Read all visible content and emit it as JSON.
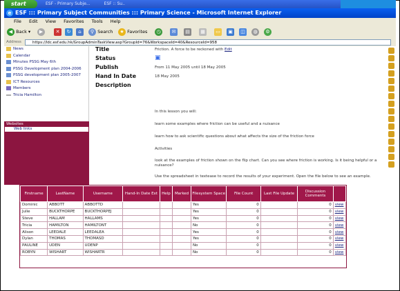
{
  "taskbar": {
    "start_label": "start",
    "items": [
      "",
      "",
      "ESF - Primary Subje...",
      "ESF :: Su.."
    ]
  },
  "window": {
    "title": "ESF ::: Primary Subject Communities ::: Primary Science - Microsoft Internet Explorer"
  },
  "menu": [
    "File",
    "Edit",
    "View",
    "Favorites",
    "Tools",
    "Help"
  ],
  "toolbar": {
    "back": "Back",
    "search": "Search",
    "favorites": "Favorites"
  },
  "address": {
    "label": "Address",
    "url": "https://ldc.esf.edu.hk/GroupAdminTaskView.asp?GroupId=76&WorkspaceId=40&ResourceId=958"
  },
  "leftnav": {
    "items": [
      "News",
      "Calendar",
      "Minutes PSSG May 6th",
      "PSSG Development plan 2004-2006",
      "PSSG development plan 2005-2007",
      "ICT Resources",
      "Members",
      "Tricia Hamilton"
    ],
    "websites_header": "Websites",
    "web_link": "Web links"
  },
  "task": {
    "title_label": "Title",
    "title_value": "Friction. A force to be reckoned with",
    "edit_link": "Edit",
    "status_label": "Status",
    "publish_label": "Publish",
    "publish_value": "From 11 May 2005 until 18 May 2005",
    "hand_in_label": "Hand In Date",
    "hand_in_value": "18 May 2005",
    "description_label": "Description",
    "paragraphs": [
      "In this lesson you will:",
      "learn some examples where friction can be useful and a nuisance",
      "learn how to ask scientific questions about what affects the size of the friction force",
      "Activities",
      "look at the examples of friction shown on the flip chart. Can you see where friction is working. Is it being helpful or a nuisance?",
      "Use the spreadsheet in textease to record the results of your experiment. Open the file below to see an example."
    ]
  },
  "table": {
    "headers": [
      "Firstname",
      "LastName",
      "Username",
      "Hand-In Date Ext",
      "Help",
      "Marked",
      "Filesystem Space",
      "File Count",
      "Last File Update",
      "Discussion Comments",
      ""
    ],
    "rows": [
      [
        "Dominic",
        "ABBOTT",
        "ABBOTTD",
        "",
        "",
        "",
        "Yes",
        "0",
        "",
        "0",
        "view"
      ],
      [
        "Julie",
        "BUCKTHORPE",
        "BUCKTHORPEJ",
        "",
        "",
        "",
        "Yes",
        "0",
        "",
        "0",
        "view"
      ],
      [
        "Steve",
        "HALLAM",
        "HALLAMS",
        "",
        "",
        "",
        "Yes",
        "0",
        "",
        "0",
        "view"
      ],
      [
        "Tricia",
        "HAMILTON",
        "HAMILTONT",
        "",
        "",
        "",
        "No",
        "0",
        "",
        "0",
        "view"
      ],
      [
        "Alison",
        "LEEDALE",
        "LEEDALEA",
        "",
        "",
        "",
        "Yes",
        "0",
        "",
        "0",
        "view"
      ],
      [
        "Dylan",
        "THOMAS",
        "THOMASD",
        "",
        "",
        "",
        "Yes",
        "0",
        "",
        "0",
        "view"
      ],
      [
        "PAULINE",
        "UDEN",
        "UDENP",
        "",
        "",
        "",
        "No",
        "0",
        "",
        "0",
        "view"
      ],
      [
        "ROBYN",
        "WISHART",
        "WISHARTR",
        "",
        "",
        "",
        "No",
        "0",
        "",
        "0",
        "view"
      ]
    ]
  },
  "colors": {
    "accent": "#a0184a",
    "xp_blue": "#0a5ff0"
  }
}
